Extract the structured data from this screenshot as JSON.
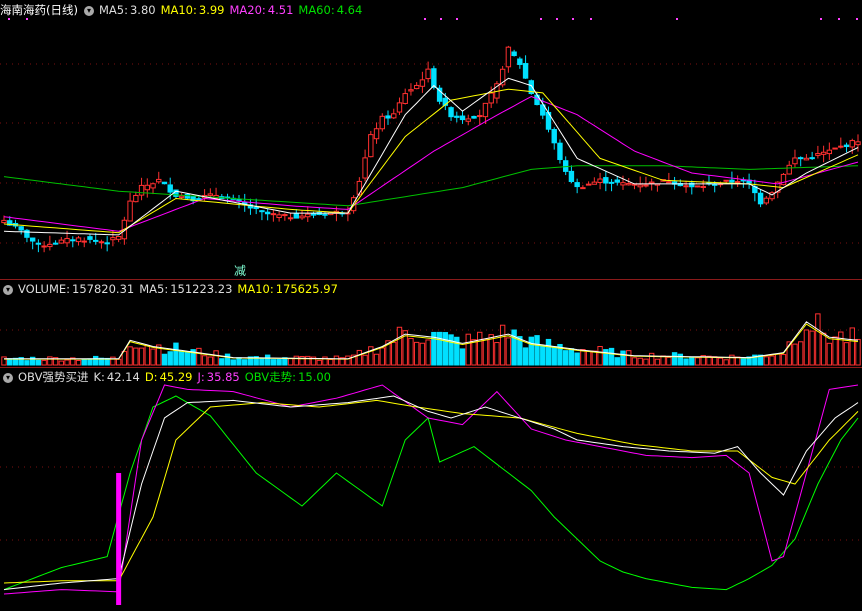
{
  "header": {
    "stock_name": "海南海药(日线)",
    "ma5_label": "MA5:",
    "ma5_value": "3.80",
    "ma10_label": "MA10:",
    "ma10_value": "3.99",
    "ma20_label": "MA20:",
    "ma20_value": "4.51",
    "ma60_label": "MA60:",
    "ma60_value": "4.64"
  },
  "volume_header": {
    "label": "VOLUME:",
    "value": "157820.31",
    "ma5_label": "MA5:",
    "ma5_value": "151223.23",
    "ma10_label": "MA10:",
    "ma10_value": "175625.97"
  },
  "indicator_header": {
    "name": "OBV强势买进",
    "k_label": "K:",
    "k_value": "42.14",
    "d_label": "D:",
    "d_value": "45.29",
    "j_label": "J:",
    "j_value": "35.85",
    "obv_label": "OBV走势:",
    "obv_value": "15.00"
  },
  "annotation": "减",
  "colors": {
    "up": "#ff3030",
    "down": "#00e0ff",
    "ma5": "#ffffff",
    "ma10": "#ffff00",
    "ma20": "#ff00ff",
    "ma60": "#00c000",
    "k": "#ffffff",
    "d": "#ffff00",
    "j": "#ff00ff",
    "obv": "#00ff00"
  },
  "chart_data": [
    {
      "type": "candlestick",
      "x_count": 150,
      "ylim": [
        2.7,
        6.2
      ],
      "anchors_close": [
        [
          0,
          3.45
        ],
        [
          3,
          3.3
        ],
        [
          6,
          3.1
        ],
        [
          9,
          3.15
        ],
        [
          13,
          3.2
        ],
        [
          18,
          3.15
        ],
        [
          20,
          3.22
        ],
        [
          22,
          3.7
        ],
        [
          24,
          3.9
        ],
        [
          27,
          4.0
        ],
        [
          30,
          3.8
        ],
        [
          33,
          3.75
        ],
        [
          37,
          3.8
        ],
        [
          41,
          3.7
        ],
        [
          45,
          3.55
        ],
        [
          49,
          3.5
        ],
        [
          53,
          3.52
        ],
        [
          57,
          3.55
        ],
        [
          60,
          3.58
        ],
        [
          62,
          4.0
        ],
        [
          64,
          4.6
        ],
        [
          66,
          4.85
        ],
        [
          68,
          4.9
        ],
        [
          70,
          5.2
        ],
        [
          72,
          5.3
        ],
        [
          74,
          5.5
        ],
        [
          76,
          5.1
        ],
        [
          78,
          4.9
        ],
        [
          80,
          4.85
        ],
        [
          83,
          4.9
        ],
        [
          86,
          5.3
        ],
        [
          88,
          5.8
        ],
        [
          90,
          5.6
        ],
        [
          92,
          5.2
        ],
        [
          94,
          4.9
        ],
        [
          96,
          4.5
        ],
        [
          98,
          4.1
        ],
        [
          100,
          3.9
        ],
        [
          102,
          3.95
        ],
        [
          104,
          4.0
        ],
        [
          108,
          3.95
        ],
        [
          112,
          3.95
        ],
        [
          116,
          4.0
        ],
        [
          120,
          3.9
        ],
        [
          124,
          3.95
        ],
        [
          128,
          4.0
        ],
        [
          130,
          3.95
        ],
        [
          132,
          3.7
        ],
        [
          134,
          3.85
        ],
        [
          136,
          4.1
        ],
        [
          138,
          4.3
        ],
        [
          140,
          4.3
        ],
        [
          144,
          4.4
        ],
        [
          149,
          4.55
        ]
      ],
      "ma5_anchors": [
        [
          0,
          3.3
        ],
        [
          20,
          3.25
        ],
        [
          30,
          3.85
        ],
        [
          50,
          3.55
        ],
        [
          60,
          3.55
        ],
        [
          70,
          4.9
        ],
        [
          75,
          5.3
        ],
        [
          80,
          4.95
        ],
        [
          88,
          5.4
        ],
        [
          92,
          5.3
        ],
        [
          100,
          4.3
        ],
        [
          110,
          3.95
        ],
        [
          130,
          3.95
        ],
        [
          134,
          3.8
        ],
        [
          140,
          4.1
        ],
        [
          149,
          4.45
        ]
      ],
      "ma10_anchors": [
        [
          0,
          3.4
        ],
        [
          20,
          3.28
        ],
        [
          30,
          3.75
        ],
        [
          50,
          3.6
        ],
        [
          60,
          3.55
        ],
        [
          70,
          4.6
        ],
        [
          78,
          5.1
        ],
        [
          88,
          5.25
        ],
        [
          94,
          5.2
        ],
        [
          104,
          4.3
        ],
        [
          115,
          4.0
        ],
        [
          130,
          3.95
        ],
        [
          136,
          3.9
        ],
        [
          149,
          4.35
        ]
      ],
      "ma20_anchors": [
        [
          0,
          3.5
        ],
        [
          20,
          3.3
        ],
        [
          35,
          3.75
        ],
        [
          50,
          3.65
        ],
        [
          60,
          3.6
        ],
        [
          75,
          4.4
        ],
        [
          85,
          4.85
        ],
        [
          92,
          5.15
        ],
        [
          100,
          4.9
        ],
        [
          110,
          4.4
        ],
        [
          120,
          4.1
        ],
        [
          135,
          3.95
        ],
        [
          149,
          4.25
        ]
      ],
      "ma60_anchors": [
        [
          0,
          4.05
        ],
        [
          20,
          3.85
        ],
        [
          40,
          3.75
        ],
        [
          60,
          3.65
        ],
        [
          80,
          3.9
        ],
        [
          92,
          4.15
        ],
        [
          100,
          4.2
        ],
        [
          115,
          4.2
        ],
        [
          130,
          4.15
        ],
        [
          149,
          4.2
        ]
      ]
    },
    {
      "type": "bar",
      "name": "volume",
      "ylim": [
        0,
        1
      ],
      "anchors": [
        [
          0,
          0.1
        ],
        [
          20,
          0.1
        ],
        [
          22,
          0.4
        ],
        [
          26,
          0.3
        ],
        [
          40,
          0.12
        ],
        [
          60,
          0.1
        ],
        [
          66,
          0.3
        ],
        [
          70,
          0.5
        ],
        [
          75,
          0.45
        ],
        [
          80,
          0.35
        ],
        [
          88,
          0.5
        ],
        [
          92,
          0.35
        ],
        [
          100,
          0.25
        ],
        [
          110,
          0.15
        ],
        [
          130,
          0.12
        ],
        [
          136,
          0.2
        ],
        [
          140,
          0.7
        ],
        [
          144,
          0.45
        ],
        [
          149,
          0.4
        ]
      ]
    },
    {
      "type": "line",
      "name": "obv",
      "ylim": [
        0,
        100
      ],
      "k_anchors": [
        [
          0,
          7
        ],
        [
          10,
          10
        ],
        [
          20,
          12
        ],
        [
          24,
          55
        ],
        [
          28,
          85
        ],
        [
          32,
          92
        ],
        [
          40,
          93
        ],
        [
          50,
          90
        ],
        [
          60,
          92
        ],
        [
          68,
          95
        ],
        [
          74,
          88
        ],
        [
          78,
          85
        ],
        [
          84,
          90
        ],
        [
          90,
          85
        ],
        [
          96,
          80
        ],
        [
          100,
          75
        ],
        [
          108,
          72
        ],
        [
          116,
          70
        ],
        [
          124,
          69
        ],
        [
          128,
          72
        ],
        [
          132,
          60
        ],
        [
          136,
          50
        ],
        [
          140,
          70
        ],
        [
          145,
          85
        ],
        [
          149,
          92
        ]
      ],
      "d_anchors": [
        [
          0,
          10
        ],
        [
          10,
          11
        ],
        [
          20,
          11
        ],
        [
          26,
          40
        ],
        [
          30,
          75
        ],
        [
          36,
          90
        ],
        [
          45,
          92
        ],
        [
          55,
          90
        ],
        [
          65,
          93
        ],
        [
          72,
          90
        ],
        [
          80,
          87
        ],
        [
          90,
          85
        ],
        [
          100,
          78
        ],
        [
          110,
          73
        ],
        [
          120,
          70
        ],
        [
          128,
          70
        ],
        [
          134,
          58
        ],
        [
          138,
          55
        ],
        [
          144,
          75
        ],
        [
          149,
          88
        ]
      ],
      "j_anchors": [
        [
          0,
          5
        ],
        [
          10,
          7
        ],
        [
          20,
          6
        ],
        [
          24,
          75
        ],
        [
          28,
          100
        ],
        [
          32,
          98
        ],
        [
          40,
          97
        ],
        [
          50,
          90
        ],
        [
          58,
          94
        ],
        [
          66,
          100
        ],
        [
          74,
          85
        ],
        [
          80,
          82
        ],
        [
          86,
          97
        ],
        [
          92,
          80
        ],
        [
          98,
          75
        ],
        [
          104,
          72
        ],
        [
          112,
          68
        ],
        [
          120,
          67
        ],
        [
          126,
          68
        ],
        [
          130,
          60
        ],
        [
          134,
          20
        ],
        [
          136,
          22
        ],
        [
          140,
          60
        ],
        [
          144,
          98
        ],
        [
          149,
          100
        ]
      ],
      "obv_anchors": [
        [
          0,
          7
        ],
        [
          10,
          17
        ],
        [
          18,
          22
        ],
        [
          22,
          60
        ],
        [
          26,
          90
        ],
        [
          30,
          95
        ],
        [
          36,
          86
        ],
        [
          44,
          60
        ],
        [
          52,
          45
        ],
        [
          58,
          60
        ],
        [
          66,
          45
        ],
        [
          70,
          75
        ],
        [
          74,
          85
        ],
        [
          76,
          65
        ],
        [
          82,
          72
        ],
        [
          88,
          60
        ],
        [
          92,
          52
        ],
        [
          96,
          40
        ],
        [
          100,
          30
        ],
        [
          104,
          20
        ],
        [
          108,
          15
        ],
        [
          112,
          12
        ],
        [
          116,
          10
        ],
        [
          120,
          8
        ],
        [
          126,
          7
        ],
        [
          130,
          12
        ],
        [
          134,
          18
        ],
        [
          138,
          30
        ],
        [
          142,
          55
        ],
        [
          146,
          75
        ],
        [
          149,
          85
        ]
      ],
      "signal_bar_x": 20
    }
  ]
}
